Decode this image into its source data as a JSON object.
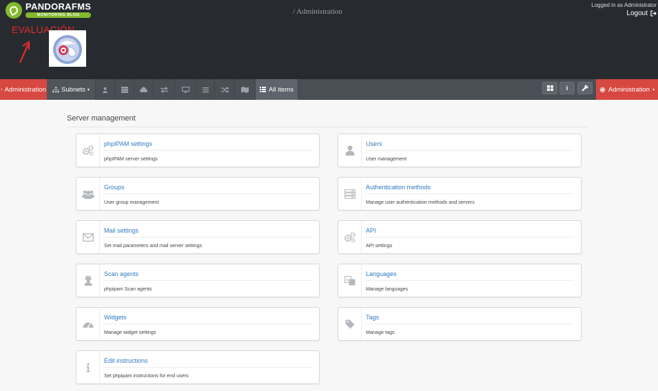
{
  "header": {
    "brand_name": "PANDORAFMS",
    "brand_sub": "MONITORING BLOG",
    "watermark": "EVALUACIÓN",
    "breadcrumb": "/ Administration",
    "logged_in": "Logged in as  Administrator",
    "logout": "Logout"
  },
  "nav": {
    "admin_left": "Administration",
    "subnets": "Subnets",
    "all_items": "All items",
    "admin_right": "Administration",
    "icons": [
      "user-icon",
      "server-icon",
      "cloud-icon",
      "exchange-icon",
      "desktop-icon",
      "list-icon",
      "random-icon",
      "map-icon"
    ],
    "tool_icons": [
      "grid-icon",
      "info-icon",
      "wrench-icon"
    ]
  },
  "section": {
    "title": "Server management"
  },
  "cards": [
    {
      "title": "phpIPAM settings",
      "desc": "phpIPAM server settings",
      "icon": "cogs-icon"
    },
    {
      "title": "Users",
      "desc": "User management",
      "icon": "user-icon"
    },
    {
      "title": "Groups",
      "desc": "User group management",
      "icon": "users-icon"
    },
    {
      "title": "Authentication methods",
      "desc": "Manage user authentication methods and servers",
      "icon": "server-icon"
    },
    {
      "title": "Mail settings",
      "desc": "Set mail parameters and mail server settings",
      "icon": "envelope-icon"
    },
    {
      "title": "API",
      "desc": "API settings",
      "icon": "cogs-icon"
    },
    {
      "title": "Scan agents",
      "desc": "phpipam Scan agents",
      "icon": "user-secret-icon"
    },
    {
      "title": "Languages",
      "desc": "Manage languages",
      "icon": "language-icon"
    },
    {
      "title": "Widgets",
      "desc": "Manage widget settings",
      "icon": "dashboard-icon"
    },
    {
      "title": "Tags",
      "desc": "Manage tags",
      "icon": "tag-icon"
    },
    {
      "title": "Edit instructions",
      "desc": "Set phpipam instructions for end users",
      "icon": "info-icon"
    }
  ]
}
